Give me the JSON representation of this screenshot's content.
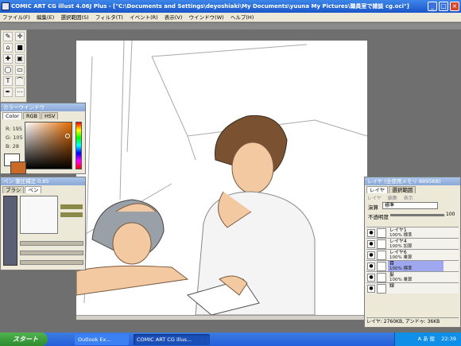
{
  "window": {
    "title": "COMIC ART CG illust 4.06J Plus - [\"C:\\Documents and Settings\\deyoshiaki\\My Documents\\yuuna My Pictures\\職員室で雑談 cg.oci\"]",
    "minimize": "_",
    "maximize": "□",
    "close": "×"
  },
  "menu": [
    "ファイル(F)",
    "編集(E)",
    "選択範囲(S)",
    "フィルタ(T)",
    "イベント(R)",
    "表示(V)",
    "ウインドウ(W)",
    "ヘルプ(H)"
  ],
  "toolbox": {
    "tools": [
      "✎",
      "✛",
      "⌂",
      "■",
      "✚",
      "▣",
      "◯",
      "▭",
      "T",
      "⌒",
      "✒",
      "⋯"
    ]
  },
  "color_panel": {
    "title": "カラーウインドウ",
    "tabs": [
      "Color",
      "RGB",
      "HSV"
    ],
    "r_label": "R: 195",
    "g_label": "G: 105",
    "b_label": "B: 28",
    "front_color": "#c3691c",
    "back_color": "#ffffff"
  },
  "pen_panel": {
    "title": "ペン 筆圧補正 0.85",
    "tabs": [
      "ブラシ",
      "ペン"
    ]
  },
  "layer_panel": {
    "title": "レイヤ (全使用メモリ 8895KB)",
    "tabs": [
      "レイヤ",
      "選択範囲"
    ],
    "menu": [
      "レイヤ",
      "編集",
      "表示"
    ],
    "blend_label": "演算",
    "blend_value": "標準",
    "opacity_label": "不透明度",
    "opacity_value": "100",
    "layers": [
      {
        "name": "レイヤ1",
        "mode": "100% 標準",
        "selected": false
      },
      {
        "name": "レイヤ4",
        "mode": "100% 加算",
        "selected": false
      },
      {
        "name": "レイヤ6",
        "mode": "100% 乗算",
        "selected": false
      },
      {
        "name": "目",
        "mode": "100% 標準",
        "selected": true
      },
      {
        "name": "髪",
        "mode": "100% 乗算",
        "selected": false
      },
      {
        "name": "線",
        "mode": "",
        "selected": false
      }
    ],
    "status": "レイヤ: 2760KB, アンドゥ: 36KB"
  },
  "taskbar": {
    "start_label": "スタート",
    "tasks": [
      "Outlook Ex...",
      "COMIC ART CG illus..."
    ],
    "tray_text": "A  あ  般",
    "clock": "22:39"
  }
}
